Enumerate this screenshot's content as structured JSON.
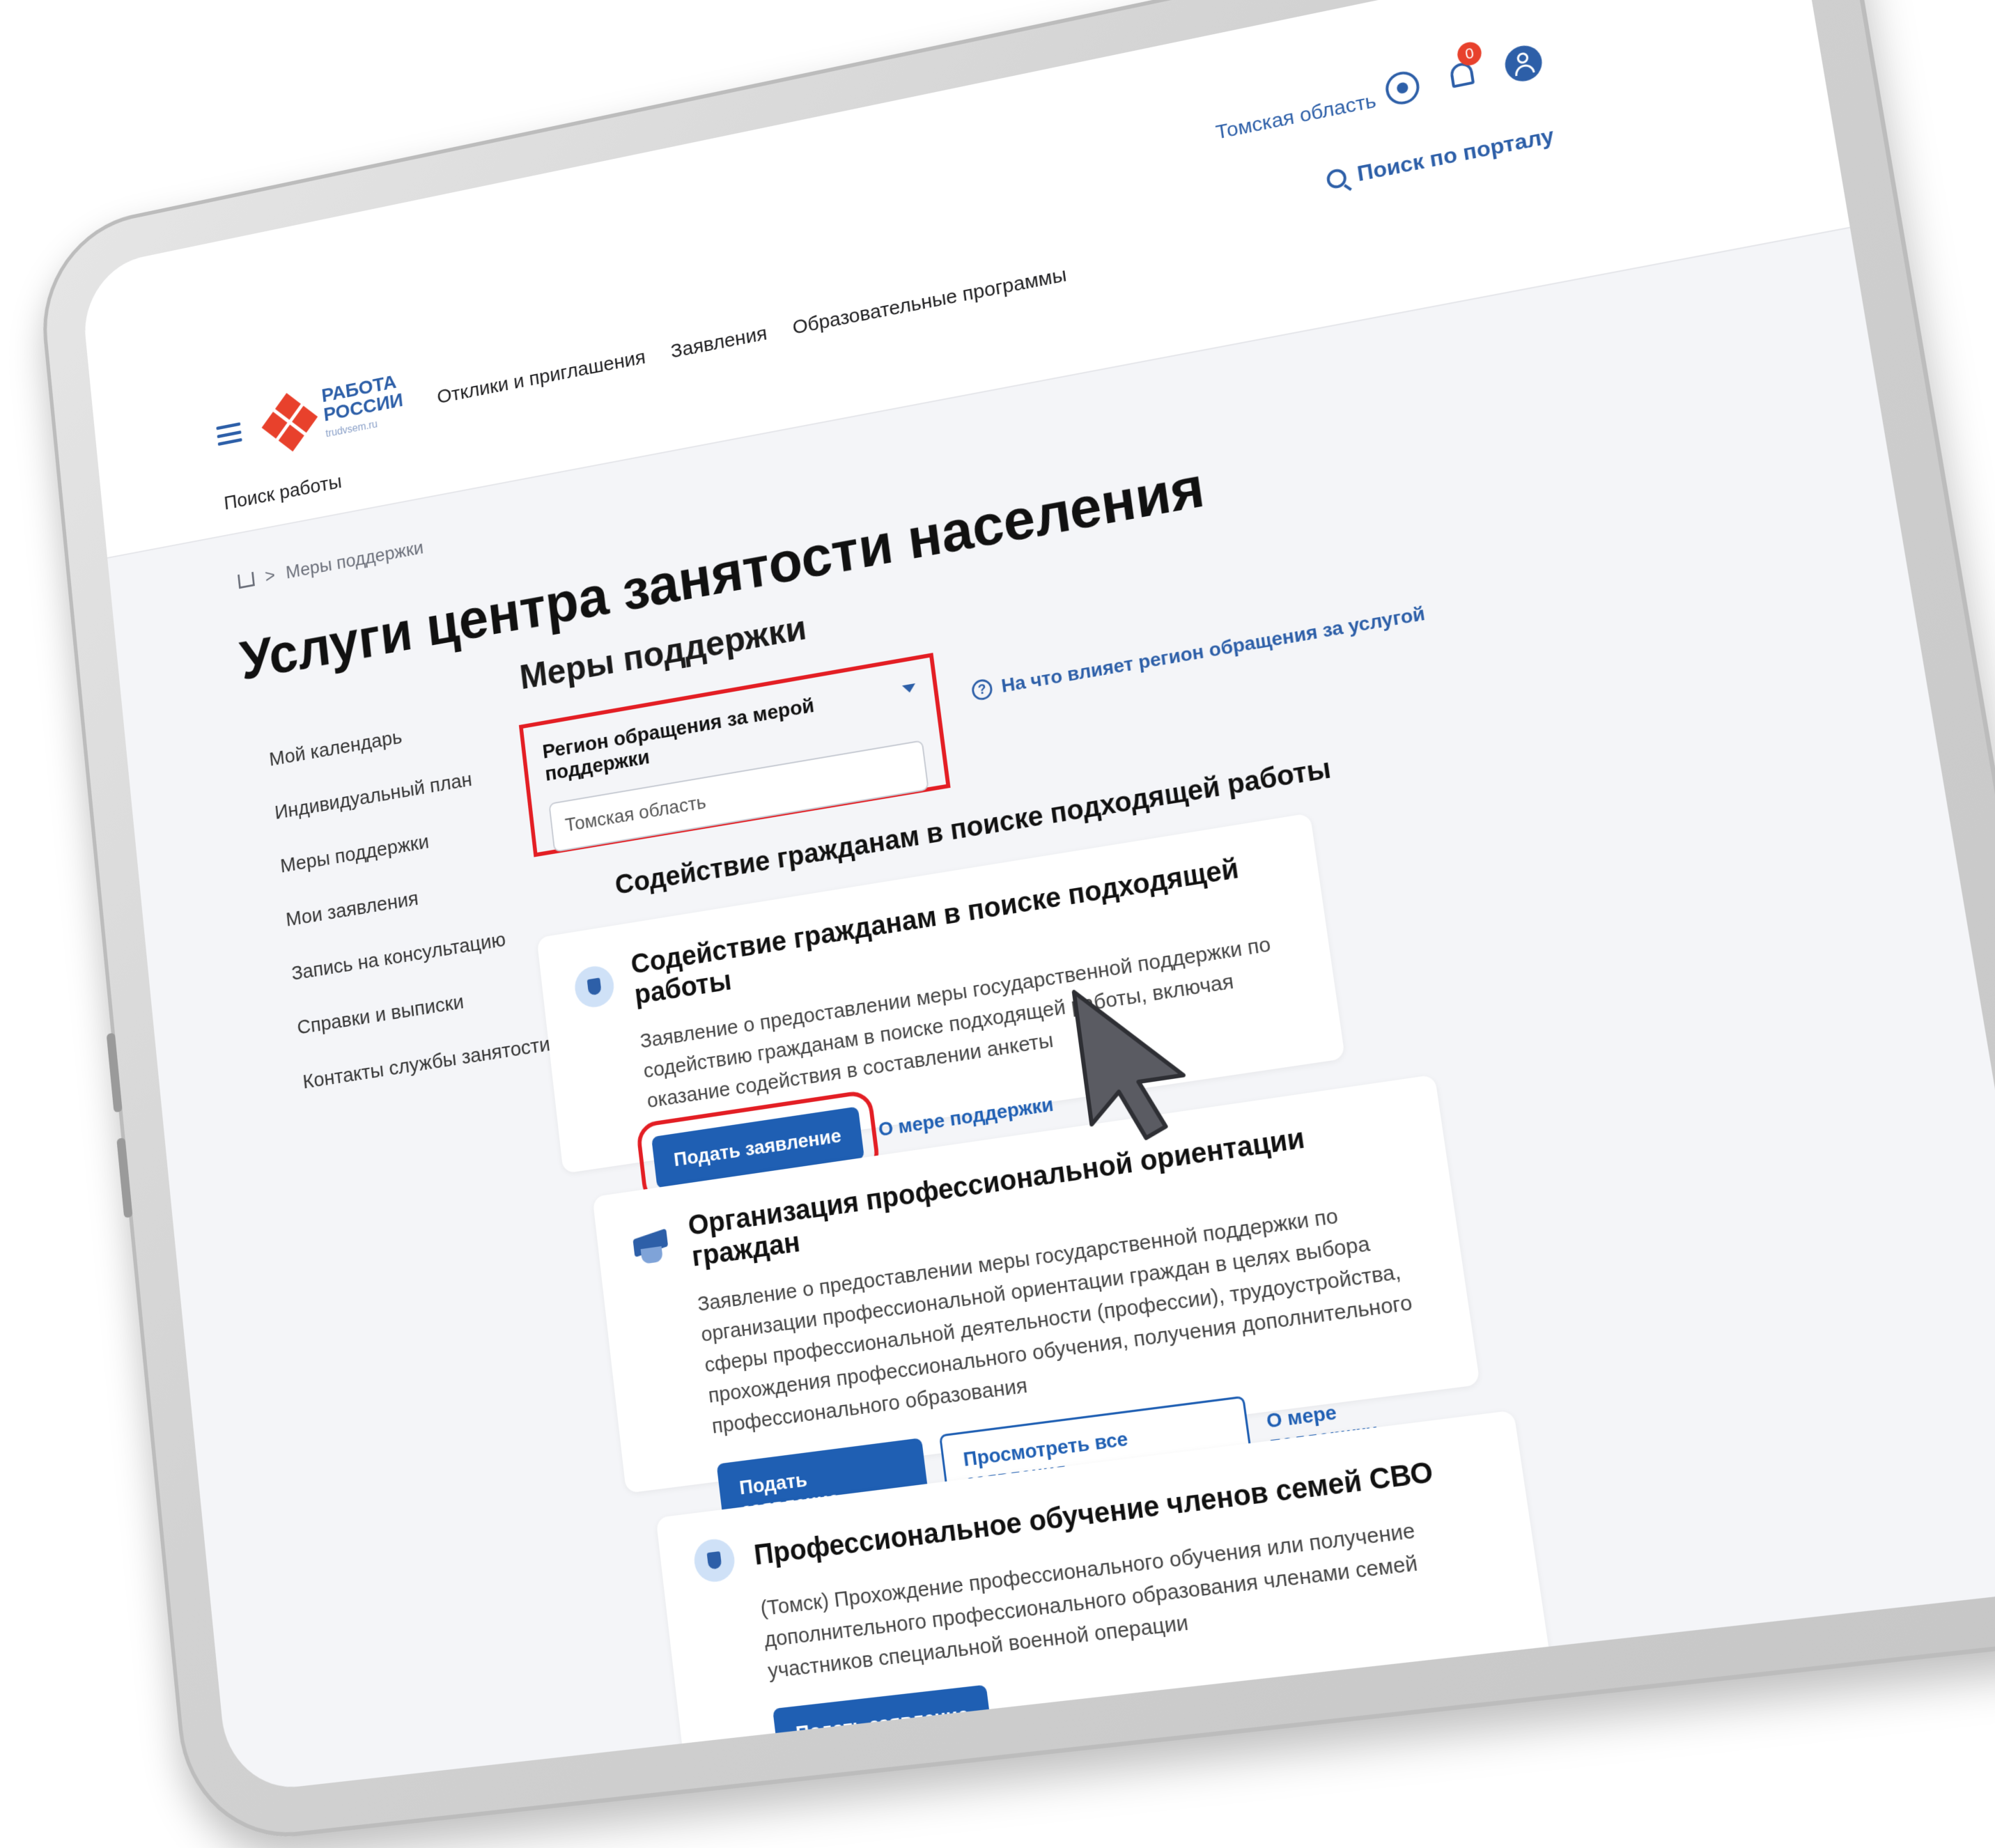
{
  "header": {
    "region": "Томская область",
    "notifications_count": "0",
    "search_label": "Поиск по порталу",
    "logo_line1": "РАБОТА",
    "logo_line2": "РОССИИ",
    "logo_sub": "trudvsem.ru",
    "nav_main": [
      "Отклики и приглашения",
      "Заявления",
      "Образовательные программы"
    ],
    "nav_sub": [
      "Поиск работы"
    ]
  },
  "breadcrumb": {
    "current": "Меры поддержки"
  },
  "page_title": "Услуги центра занятости населения",
  "sidebar": {
    "items": [
      "Мой календарь",
      "Индивидуальный план",
      "Меры поддержки",
      "Мои заявления",
      "Запись на консультацию",
      "Справки и выписки",
      "Контакты службы занятости"
    ]
  },
  "main": {
    "section_title": "Меры поддержки",
    "region_label": "Регион обращения за мерой поддержки",
    "region_value": "Томская область",
    "region_help": "На что влияет регион обращения за услугой",
    "group_title": "Содействие гражданам в поиске подходящей работы",
    "cards": [
      {
        "title": "Содействие гражданам в поиске подходящей работы",
        "text": "Заявление о предоставлении меры государственной поддержки по содействию гражданам в поиске подходящей работы, включая оказание содействия в составлении анкеты",
        "primary": "Подать заявление",
        "link": "О мере поддержки"
      },
      {
        "title": "Организация профессиональной ориентации граждан",
        "text": "Заявление о предоставлении меры государственной поддержки по организации профессиональной ориентации граждан в целях выбора сферы профессиональной деятельности (профессии), трудоустройства, прохождения профессионального обучения, получения дополнительного профессионального образования",
        "primary": "Подать заявление",
        "secondary": "Просмотреть все заявления",
        "link": "О мере поддержки"
      },
      {
        "title": "Профессиональное обучение членов семей СВО",
        "text": "(Томск) Прохождение профессионального обучения или получение дополнительного профессионального образования членами семей участников специальной военной операции",
        "primary": "Подать заявление"
      }
    ]
  },
  "colors": {
    "accent": "#1f5fb3",
    "highlight": "#e31e24",
    "logo_red": "#e8412c"
  }
}
